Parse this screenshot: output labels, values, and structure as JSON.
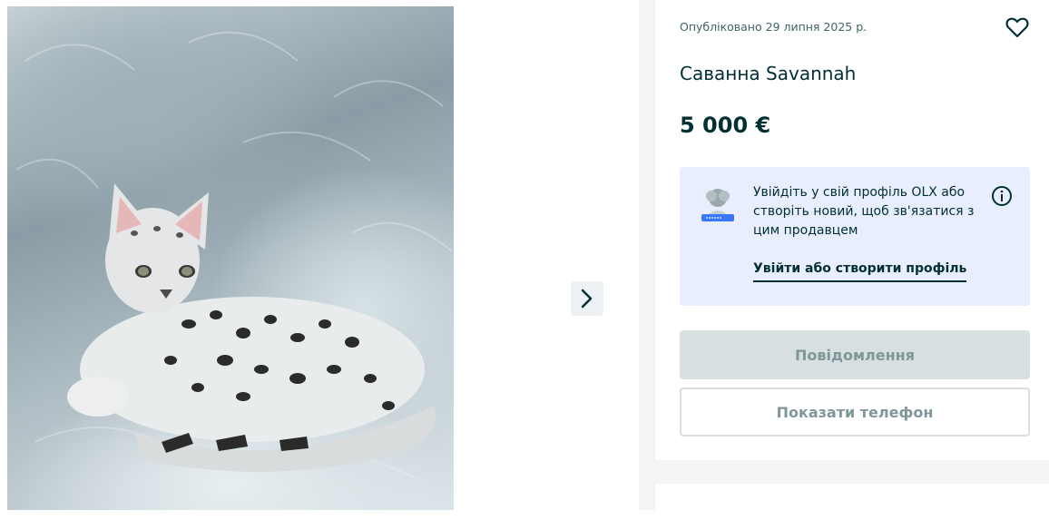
{
  "gallery": {
    "photo_subject": "savannah-kitten-photo",
    "next_icon": "chevron-right-icon"
  },
  "listing": {
    "published": "Опубліковано 29 липня 2025 р.",
    "title": "Саванна Savannah",
    "price": "5 000 €",
    "favorite_icon": "heart-icon"
  },
  "login_prompt": {
    "text": "Увійдіть у свій профіль OLX або створіть новий, щоб зв'язатися з цим продавцем",
    "link": "Увійти або створити профіль",
    "info_icon": "info-icon"
  },
  "actions": {
    "message": "Повідомлення",
    "show_phone": "Показати телефон"
  },
  "colors": {
    "text": "#002f34",
    "login_bg": "#e8eefe",
    "disabled_bg": "#d8dfe0",
    "disabled_text": "#7f9799",
    "sidebar_bg": "#f2f4f5"
  }
}
